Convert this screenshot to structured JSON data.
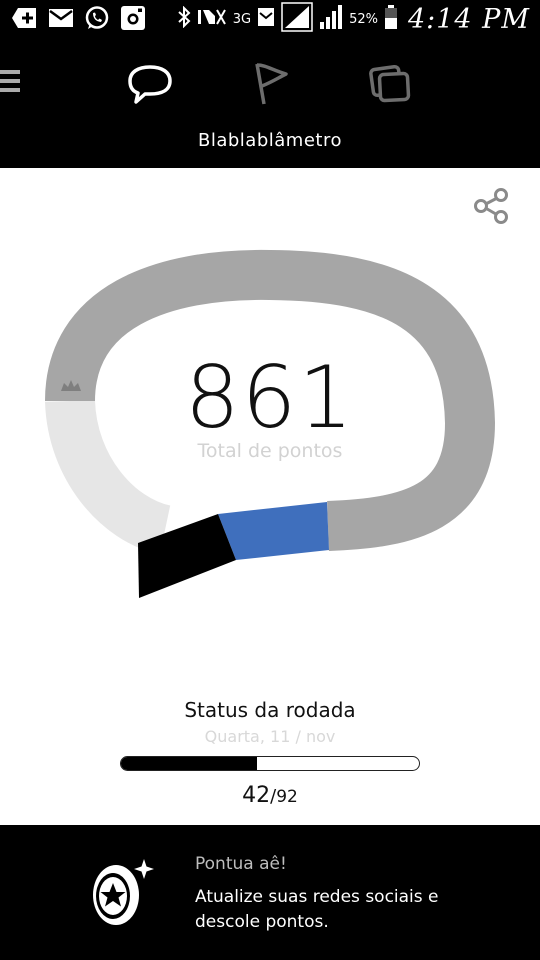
{
  "status_bar": {
    "network_label": "3G",
    "battery_text": "52%",
    "time": "4:14 PM",
    "icons": [
      "plus-icon",
      "mail-icon",
      "whatsapp-icon",
      "instagram-icon",
      "bluetooth-icon",
      "mute-icon",
      "network-3g-icon",
      "sms-icon",
      "signal-icon",
      "signal-icon",
      "battery-icon"
    ]
  },
  "header": {
    "title": "Blablablâmetro",
    "nav": [
      "chat-bubble-icon",
      "flag-icon",
      "cards-icon"
    ],
    "active_nav": "chat-bubble-icon"
  },
  "score": {
    "value": "861",
    "label": "Total de pontos"
  },
  "round_status": {
    "title": "Status da rodada",
    "date": "Quarta, 11 / nov",
    "current": "42",
    "separator": "/",
    "total": "92",
    "progress_fraction": 0.4565
  },
  "promo": {
    "title": "Pontua aê!",
    "text": "Atualize suas redes sociais e descole pontos."
  },
  "colors": {
    "background": "#000000",
    "content_bg": "#ffffff",
    "gauge_track": "#a6a6a6",
    "gauge_light": "#e6e6e6",
    "gauge_blue": "#3f6fbd",
    "gauge_black": "#000000",
    "muted_text": "#d2d2d2"
  }
}
